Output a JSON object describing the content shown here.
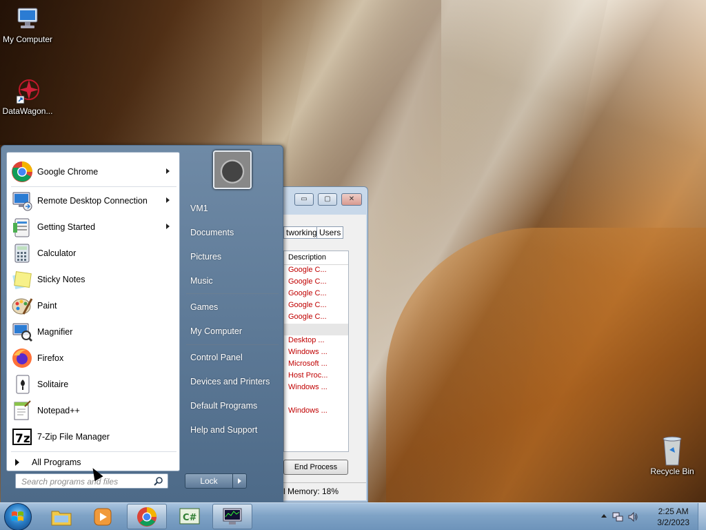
{
  "desktop": {
    "icons": [
      {
        "label": "My Computer"
      },
      {
        "label": "DataWagon..."
      },
      {
        "label": "Recycle Bin"
      }
    ]
  },
  "task_manager": {
    "tabs": [
      "tworking",
      "Users"
    ],
    "column_header": "Description",
    "rows": [
      "Google C...",
      "Google C...",
      "Google C...",
      "Google C...",
      "Google C...",
      "",
      "Desktop ...",
      "Windows ...",
      "Microsoft ...",
      "Host Proc...",
      "Windows ...",
      "",
      "Windows ..."
    ],
    "end_process": "End Process",
    "status": "l Memory: 18%"
  },
  "start_menu": {
    "programs": [
      {
        "label": "Google Chrome",
        "icon": "chrome-icon",
        "has_submenu": true
      },
      {
        "label": "Remote Desktop Connection",
        "icon": "remote-desktop-icon",
        "has_submenu": true
      },
      {
        "label": "Getting Started",
        "icon": "getting-started-icon",
        "has_submenu": true
      },
      {
        "label": "Calculator",
        "icon": "calculator-icon",
        "has_submenu": false
      },
      {
        "label": "Sticky Notes",
        "icon": "sticky-notes-icon",
        "has_submenu": false
      },
      {
        "label": "Paint",
        "icon": "paint-icon",
        "has_submenu": false
      },
      {
        "label": "Magnifier",
        "icon": "magnifier-icon",
        "has_submenu": false
      },
      {
        "label": "Firefox",
        "icon": "firefox-icon",
        "has_submenu": false
      },
      {
        "label": "Solitaire",
        "icon": "solitaire-icon",
        "has_submenu": false
      },
      {
        "label": "Notepad++",
        "icon": "notepadpp-icon",
        "has_submenu": false
      },
      {
        "label": "7-Zip File Manager",
        "icon": "7zip-icon",
        "has_submenu": false
      }
    ],
    "all_programs": "All Programs",
    "search_placeholder": "Search programs and files",
    "right": [
      "VM1",
      "Documents",
      "Pictures",
      "Music",
      "Games",
      "My Computer",
      "Control Panel",
      "Devices and Printers",
      "Default Programs",
      "Help and Support"
    ],
    "lock": "Lock"
  },
  "taskbar": {
    "time": "2:25 AM",
    "date": "3/2/2023"
  },
  "colors": {
    "taskbar": "#7fa3c6",
    "start_menu_right": "#5a7797",
    "task_desc_text": "#c00000"
  }
}
